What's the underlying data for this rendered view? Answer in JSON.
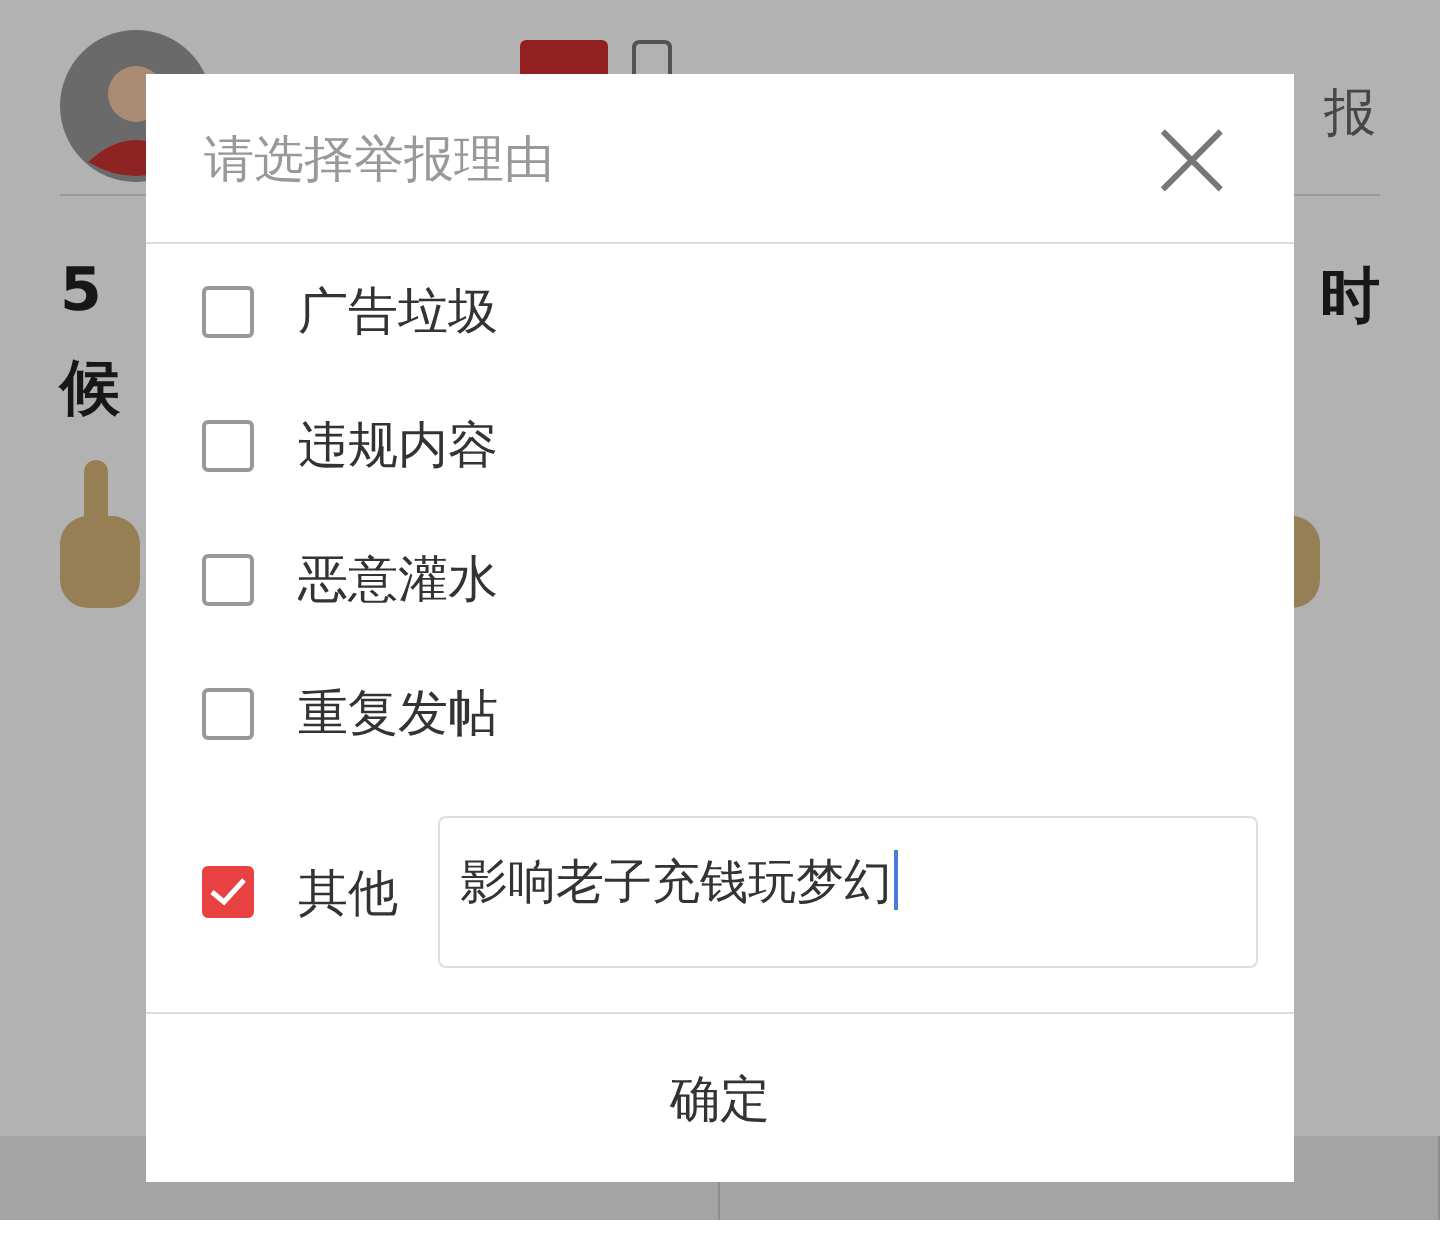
{
  "post": {
    "report_link": "报",
    "title_pieces": [
      "5",
      "时",
      "候"
    ]
  },
  "dialog": {
    "title": "请选择举报理由",
    "close": "×",
    "options": [
      {
        "kind": "check",
        "label": "广告垃圾",
        "checked": false
      },
      {
        "kind": "check",
        "label": "违规内容",
        "checked": false
      },
      {
        "kind": "check",
        "label": "恶意灌水",
        "checked": false
      },
      {
        "kind": "check",
        "label": "重复发帖",
        "checked": false
      },
      {
        "kind": "input",
        "label": "其他",
        "checked": true,
        "value": "影响老子充钱玩梦幻"
      }
    ],
    "confirm": "确定"
  }
}
